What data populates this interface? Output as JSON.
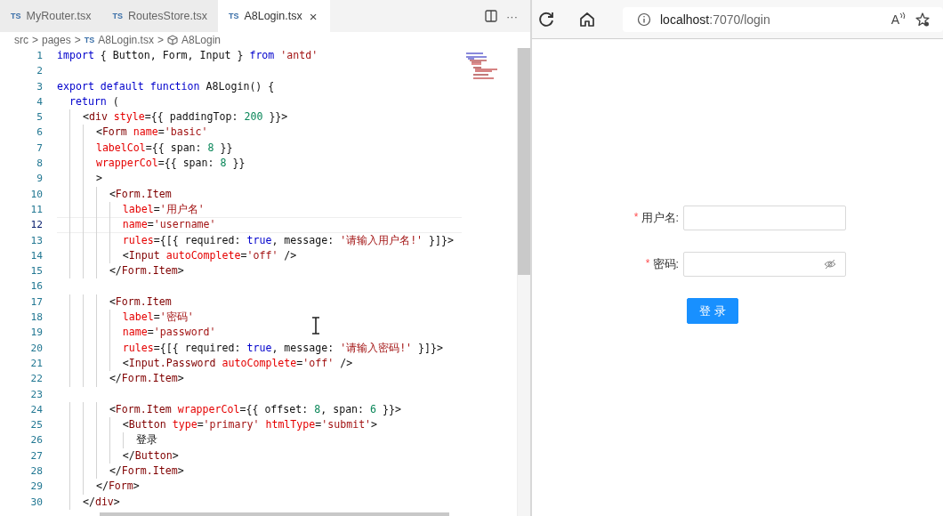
{
  "editor": {
    "tabs": [
      {
        "badge": "TS",
        "label": "MyRouter.tsx",
        "selected": false
      },
      {
        "badge": "TS",
        "label": "RoutesStore.tsx",
        "selected": false
      },
      {
        "badge": "TS",
        "label": "A8Login.tsx",
        "selected": true,
        "close": "×"
      }
    ],
    "actions": {
      "more": "···"
    },
    "breadcrumb": [
      {
        "kind": "folder",
        "label": "src"
      },
      {
        "kind": "folder",
        "label": "pages"
      },
      {
        "kind": "file",
        "badge": "TS",
        "label": "A8Login.tsx"
      },
      {
        "kind": "symbol",
        "label": "A8Login"
      }
    ],
    "separator": ">",
    "lines": [
      {
        "n": "1",
        "current": false,
        "tokens": [
          {
            "kind": "kw",
            "text": "import"
          },
          {
            "kind": "p",
            "text": " { Button, Form, Input } "
          },
          {
            "kind": "kw",
            "text": "from"
          },
          {
            "kind": "str",
            "text": " 'antd'"
          }
        ]
      },
      {
        "n": "2",
        "current": false
      },
      {
        "n": "3",
        "current": false,
        "tokens": [
          {
            "kind": "kw",
            "text": "export default function"
          },
          {
            "kind": "p",
            "text": " A8Login() {"
          }
        ]
      },
      {
        "n": "4",
        "current": false,
        "tokens": [
          {
            "kind": "kw",
            "text": "  return"
          },
          {
            "kind": "p",
            "text": " ("
          }
        ]
      },
      {
        "n": "5",
        "current": false,
        "tokens": [
          {
            "kind": "p",
            "text": "    <"
          },
          {
            "kind": "tag",
            "text": "div"
          },
          {
            "kind": "attr",
            "text": " style"
          },
          {
            "kind": "p",
            "text": "={{ paddingTop: "
          },
          {
            "kind": "num",
            "text": "200"
          },
          {
            "kind": "p",
            "text": " }}>"
          }
        ]
      },
      {
        "n": "6",
        "current": false,
        "tokens": [
          {
            "kind": "p",
            "text": "      <"
          },
          {
            "kind": "tag",
            "text": "Form"
          },
          {
            "kind": "attr",
            "text": " name"
          },
          {
            "kind": "p",
            "text": "="
          },
          {
            "kind": "str",
            "text": "'basic'"
          }
        ]
      },
      {
        "n": "7",
        "current": false,
        "tokens": [
          {
            "kind": "attr",
            "text": "      labelCol"
          },
          {
            "kind": "p",
            "text": "={{ span: "
          },
          {
            "kind": "num",
            "text": "8"
          },
          {
            "kind": "p",
            "text": " }}"
          }
        ]
      },
      {
        "n": "8",
        "current": false,
        "tokens": [
          {
            "kind": "attr",
            "text": "      wrapperCol"
          },
          {
            "kind": "p",
            "text": "={{ span: "
          },
          {
            "kind": "num",
            "text": "8"
          },
          {
            "kind": "p",
            "text": " }}"
          }
        ]
      },
      {
        "n": "9",
        "current": false,
        "tokens": [
          {
            "kind": "p",
            "text": "      >"
          }
        ]
      },
      {
        "n": "10",
        "current": false,
        "tokens": [
          {
            "kind": "p",
            "text": "        <"
          },
          {
            "kind": "tag",
            "text": "Form.Item"
          }
        ]
      },
      {
        "n": "11",
        "current": false,
        "tokens": [
          {
            "kind": "attr",
            "text": "          label"
          },
          {
            "kind": "p",
            "text": "="
          },
          {
            "kind": "str",
            "text": "'用户名'"
          }
        ]
      },
      {
        "n": "12",
        "current": true,
        "tokens": [
          {
            "kind": "attr",
            "text": "          name"
          },
          {
            "kind": "p",
            "text": "="
          },
          {
            "kind": "str",
            "text": "'username'"
          }
        ]
      },
      {
        "n": "13",
        "current": false,
        "tokens": [
          {
            "kind": "attr",
            "text": "          rules"
          },
          {
            "kind": "p",
            "text": "={[{ required: "
          },
          {
            "kind": "kw",
            "text": "true"
          },
          {
            "kind": "p",
            "text": ", message: "
          },
          {
            "kind": "str",
            "text": "'请输入用户名!'"
          },
          {
            "kind": "p",
            "text": " }]}>"
          }
        ]
      },
      {
        "n": "14",
        "current": false,
        "tokens": [
          {
            "kind": "p",
            "text": "          <"
          },
          {
            "kind": "tag",
            "text": "Input"
          },
          {
            "kind": "attr",
            "text": " autoComplete"
          },
          {
            "kind": "p",
            "text": "="
          },
          {
            "kind": "str",
            "text": "'off'"
          },
          {
            "kind": "p",
            "text": " />"
          }
        ]
      },
      {
        "n": "15",
        "current": false,
        "tokens": [
          {
            "kind": "p",
            "text": "        </"
          },
          {
            "kind": "tag",
            "text": "Form.Item"
          },
          {
            "kind": "p",
            "text": ">"
          }
        ]
      },
      {
        "n": "16",
        "current": false
      },
      {
        "n": "17",
        "current": false,
        "tokens": [
          {
            "kind": "p",
            "text": "        <"
          },
          {
            "kind": "tag",
            "text": "Form.Item"
          }
        ]
      },
      {
        "n": "18",
        "current": false,
        "tokens": [
          {
            "kind": "attr",
            "text": "          label"
          },
          {
            "kind": "p",
            "text": "="
          },
          {
            "kind": "str",
            "text": "'密码'"
          }
        ]
      },
      {
        "n": "19",
        "current": false,
        "tokens": [
          {
            "kind": "attr",
            "text": "          name"
          },
          {
            "kind": "p",
            "text": "="
          },
          {
            "kind": "str",
            "text": "'password'"
          }
        ]
      },
      {
        "n": "20",
        "current": false,
        "tokens": [
          {
            "kind": "attr",
            "text": "          rules"
          },
          {
            "kind": "p",
            "text": "={[{ required: "
          },
          {
            "kind": "kw",
            "text": "true"
          },
          {
            "kind": "p",
            "text": ", message: "
          },
          {
            "kind": "str",
            "text": "'请输入密码!'"
          },
          {
            "kind": "p",
            "text": " }]}>"
          }
        ]
      },
      {
        "n": "21",
        "current": false,
        "tokens": [
          {
            "kind": "p",
            "text": "          <"
          },
          {
            "kind": "tag",
            "text": "Input.Password"
          },
          {
            "kind": "attr",
            "text": " autoComplete"
          },
          {
            "kind": "p",
            "text": "="
          },
          {
            "kind": "str",
            "text": "'off'"
          },
          {
            "kind": "p",
            "text": " />"
          }
        ]
      },
      {
        "n": "22",
        "current": false,
        "tokens": [
          {
            "kind": "p",
            "text": "        </"
          },
          {
            "kind": "tag",
            "text": "Form.Item"
          },
          {
            "kind": "p",
            "text": ">"
          }
        ]
      },
      {
        "n": "23",
        "current": false
      },
      {
        "n": "24",
        "current": false,
        "tokens": [
          {
            "kind": "p",
            "text": "        <"
          },
          {
            "kind": "tag",
            "text": "Form.Item"
          },
          {
            "kind": "attr",
            "text": " wrapperCol"
          },
          {
            "kind": "p",
            "text": "={{ offset: "
          },
          {
            "kind": "num",
            "text": "8"
          },
          {
            "kind": "p",
            "text": ", span: "
          },
          {
            "kind": "num",
            "text": "6"
          },
          {
            "kind": "p",
            "text": " }}>"
          }
        ]
      },
      {
        "n": "25",
        "current": false,
        "tokens": [
          {
            "kind": "p",
            "text": "          <"
          },
          {
            "kind": "tag",
            "text": "Button"
          },
          {
            "kind": "attr",
            "text": " type"
          },
          {
            "kind": "p",
            "text": "="
          },
          {
            "kind": "str",
            "text": "'primary'"
          },
          {
            "kind": "attr",
            "text": " htmlType"
          },
          {
            "kind": "p",
            "text": "="
          },
          {
            "kind": "str",
            "text": "'submit'"
          },
          {
            "kind": "p",
            "text": ">"
          }
        ]
      },
      {
        "n": "26",
        "current": false,
        "tokens": [
          {
            "kind": "p",
            "text": "            登录"
          }
        ]
      },
      {
        "n": "27",
        "current": false,
        "tokens": [
          {
            "kind": "p",
            "text": "          </"
          },
          {
            "kind": "tag",
            "text": "Button"
          },
          {
            "kind": "p",
            "text": ">"
          }
        ]
      },
      {
        "n": "28",
        "current": false,
        "tokens": [
          {
            "kind": "p",
            "text": "        </"
          },
          {
            "kind": "tag",
            "text": "Form.Item"
          },
          {
            "kind": "p",
            "text": ">"
          }
        ]
      },
      {
        "n": "29",
        "current": false,
        "tokens": [
          {
            "kind": "p",
            "text": "      </"
          },
          {
            "kind": "tag",
            "text": "Form"
          },
          {
            "kind": "p",
            "text": ">"
          }
        ]
      },
      {
        "n": "30",
        "current": false,
        "tokens": [
          {
            "kind": "p",
            "text": "    </"
          },
          {
            "kind": "tag",
            "text": "div"
          },
          {
            "kind": "p",
            "text": ">"
          }
        ]
      }
    ]
  },
  "browser": {
    "address": {
      "host": "localhost",
      "rest": ":7070/login"
    },
    "read_aloud": "A",
    "form": {
      "fields": [
        {
          "required_mark": "*",
          "label": "用户名:",
          "kind": "text"
        },
        {
          "required_mark": "*",
          "label": "密码:",
          "kind": "password"
        }
      ],
      "submit": "登 录"
    }
  }
}
